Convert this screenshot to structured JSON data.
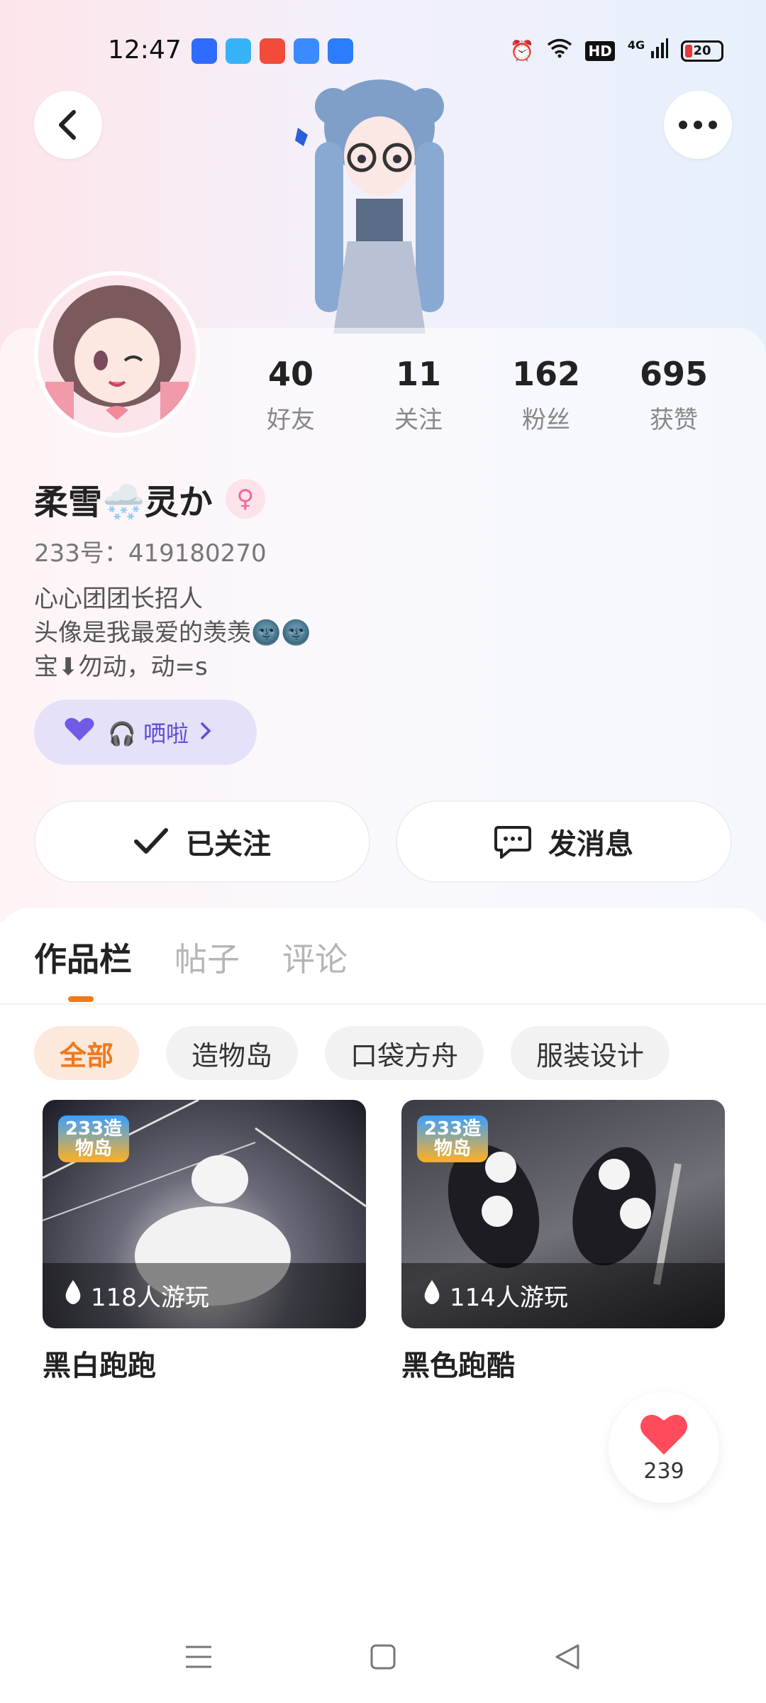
{
  "status_bar": {
    "time": "12:47",
    "battery_level": "20",
    "network": "4G",
    "hd_label": "HD"
  },
  "profile": {
    "nickname_part1": "柔雪",
    "nickname_part2": "灵か",
    "user_id_line": "233号：419180270",
    "bio_lines": [
      "心心团团长招人",
      "头像是我最爱的羡羡🌚🌚",
      "宝⬇勿动，动=s"
    ],
    "voice_chip_label": "🎧 哂啦"
  },
  "stats": [
    {
      "value": "40",
      "label": "好友"
    },
    {
      "value": "11",
      "label": "关注"
    },
    {
      "value": "162",
      "label": "粉丝"
    },
    {
      "value": "695",
      "label": "获赞"
    }
  ],
  "actions": {
    "follow_label": "已关注",
    "message_label": "发消息"
  },
  "tabs": [
    "作品栏",
    "帖子",
    "评论"
  ],
  "filter_chips": [
    "全部",
    "造物岛",
    "口袋方舟",
    "服装设计"
  ],
  "works": [
    {
      "title": "黑白跑跑",
      "plays": "118人游玩",
      "logo": "233造物岛"
    },
    {
      "title": "黑色跑酷",
      "plays": "114人游玩",
      "logo": "233造物岛"
    }
  ],
  "like_fab": {
    "count": "239"
  },
  "colors": {
    "accent": "#f07a1a",
    "voice_chip_bg": "#e5e1f8",
    "voice_text": "#5b4ed6",
    "heart": "#ff4b5c"
  }
}
